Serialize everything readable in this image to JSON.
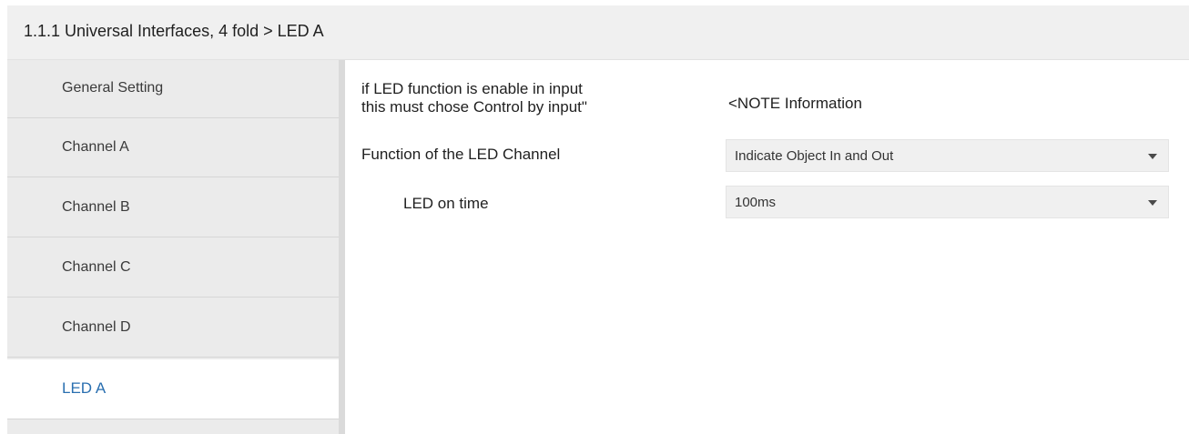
{
  "header": {
    "title": "1.1.1 Universal Interfaces, 4 fold > LED A"
  },
  "sidebar": {
    "items": [
      {
        "label": "General Setting",
        "active": false
      },
      {
        "label": "Channel A",
        "active": false
      },
      {
        "label": "Channel B",
        "active": false
      },
      {
        "label": "Channel C",
        "active": false
      },
      {
        "label": "Channel D",
        "active": false
      },
      {
        "label": "LED A",
        "active": true
      }
    ]
  },
  "main": {
    "note": {
      "label_line1": "if LED function is enable in input",
      "label_line2": "this must chose Control by input\"",
      "value": "<NOTE Information"
    },
    "function": {
      "label": "Function of the LED Channel",
      "value": "Indicate Object In and Out"
    },
    "led_on_time": {
      "label": "LED on time",
      "value": "100ms"
    }
  },
  "colors": {
    "active_item": "#2a6fb0",
    "sidebar_bg": "#ebebeb",
    "header_bg": "#f0f0f0"
  }
}
